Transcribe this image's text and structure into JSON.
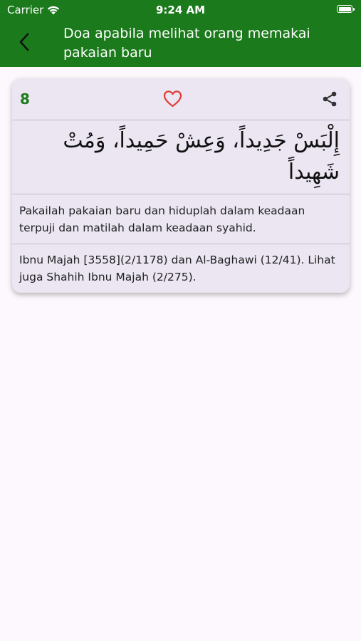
{
  "status_bar": {
    "carrier": "Carrier",
    "time": "9:24 AM",
    "wifi_icon": "wifi-icon",
    "battery_icon": "battery-icon"
  },
  "header": {
    "back_icon": "chevron-left-icon",
    "title": "Doa apabila melihat orang memakai pakaian baru"
  },
  "card": {
    "number": "8",
    "favorite_icon": "heart-outline-icon",
    "share_icon": "share-icon",
    "arabic": "إِلْبَسْ جَدِيداً، وَعِشْ حَمِيداً، وَمُتْ شَهِيداً",
    "translation": "Pakailah pakaian baru dan hiduplah dalam keadaan terpuji dan matilah dalam keadaan syahid.",
    "reference": "Ibnu Majah [3558](2/1178) dan Al-Baghawi (12/41). Lihat juga Shahih Ibnu Majah (2/275)."
  },
  "colors": {
    "primary": "#1b7a1b",
    "heart": "#e0403a",
    "card_background": "#ebe6f2",
    "page_background": "#fcf8fd"
  }
}
